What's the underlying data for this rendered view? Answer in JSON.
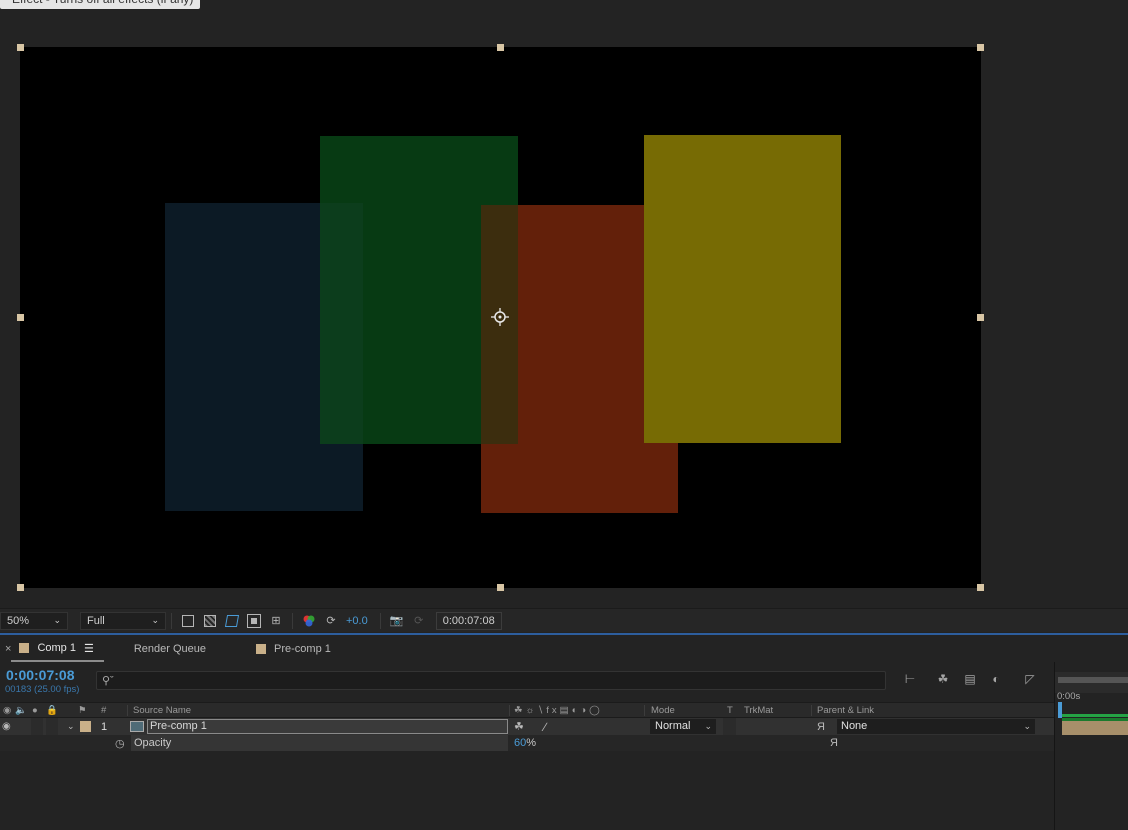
{
  "tooltip": "Effect - Turns off all effects (if any)",
  "canvas": {
    "rects": [
      {
        "name": "blue-rect",
        "color": "#0c1a25"
      },
      {
        "name": "green-rect",
        "color": "#073a13"
      },
      {
        "name": "red-rect",
        "color": "#63200a"
      },
      {
        "name": "yellow-rect",
        "color": "#776b04"
      }
    ]
  },
  "viewer_toolbar": {
    "magnification": "50%",
    "resolution": "Full",
    "exposure": "+0.0",
    "timecode": "0:00:07:08"
  },
  "tabs": [
    {
      "label": "Comp 1",
      "active": true
    },
    {
      "label": "Render Queue",
      "active": false
    },
    {
      "label": "Pre-comp 1",
      "active": false
    }
  ],
  "timeline": {
    "current_time": "0:00:07:08",
    "frame_info": "00183 (25.00 fps)",
    "columns": {
      "number": "#",
      "source_name": "Source Name",
      "mode": "Mode",
      "t": "T",
      "trkmat": "TrkMat",
      "parent": "Parent & Link"
    },
    "layer": {
      "number": "1",
      "name": "Pre-comp 1",
      "mode": "Normal",
      "parent": "None"
    },
    "property": {
      "name": "Opacity",
      "value": "60",
      "unit": "%"
    },
    "ruler_label": "0:00s"
  }
}
